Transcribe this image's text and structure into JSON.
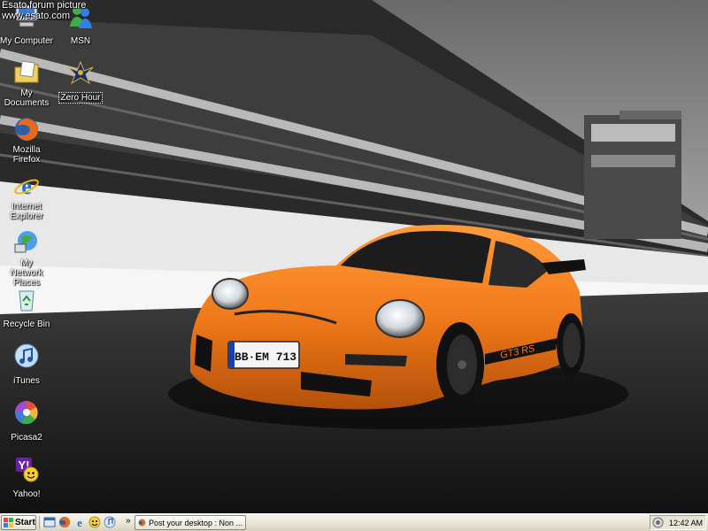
{
  "watermark": {
    "line1": "Esato forum picture",
    "line2": "www.esato.com"
  },
  "desktop_icons": [
    {
      "label": "My Computer",
      "icon": "my-computer-icon"
    },
    {
      "label": "MSN",
      "icon": "msn-icon"
    },
    {
      "label": "My Documents",
      "icon": "my-documents-icon"
    },
    {
      "label": "Zero Hour",
      "icon": "zero-hour-icon"
    },
    {
      "label": "Mozilla Firefox",
      "icon": "firefox-icon"
    },
    {
      "label": "Internet Explorer",
      "icon": "internet-explorer-icon"
    },
    {
      "label": "My Network Places",
      "icon": "network-places-icon"
    },
    {
      "label": "Recycle Bin",
      "icon": "recycle-bin-icon"
    },
    {
      "label": "iTunes",
      "icon": "itunes-icon"
    },
    {
      "label": "Picasa2",
      "icon": "picasa-icon"
    },
    {
      "label": "Yahoo!",
      "icon": "yahoo-icon"
    }
  ],
  "wallpaper": {
    "license_plate": "BB·EM 713",
    "side_decal": "GT3 RS"
  },
  "taskbar": {
    "start_label": "Start",
    "quick_launch": [
      "show-desktop-icon",
      "firefox-icon",
      "internet-explorer-icon",
      "messenger-icon",
      "winamp-icon"
    ],
    "chevron": "»",
    "task_label": "Post your desktop : Non ...",
    "clock": "12:42 AM"
  },
  "colors": {
    "car_orange": "#f07a1a",
    "taskbar": "#ece9d8",
    "xp_blue": "#245edb"
  }
}
